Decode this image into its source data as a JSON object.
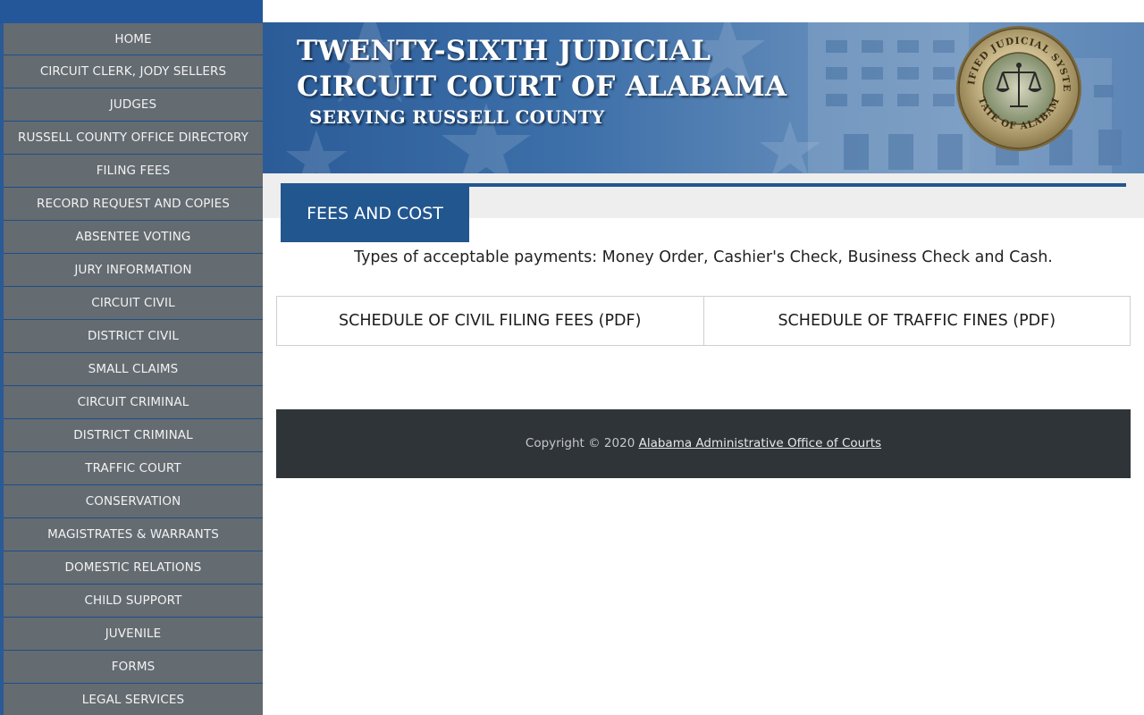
{
  "sidebar": {
    "items": [
      {
        "label": "HOME"
      },
      {
        "label": "CIRCUIT CLERK, JODY SELLERS"
      },
      {
        "label": "JUDGES"
      },
      {
        "label": "RUSSELL COUNTY OFFICE DIRECTORY"
      },
      {
        "label": "FILING FEES"
      },
      {
        "label": "RECORD REQUEST AND COPIES"
      },
      {
        "label": "ABSENTEE VOTING"
      },
      {
        "label": "JURY INFORMATION"
      },
      {
        "label": "CIRCUIT CIVIL"
      },
      {
        "label": "DISTRICT CIVIL"
      },
      {
        "label": "SMALL CLAIMS"
      },
      {
        "label": "CIRCUIT CRIMINAL"
      },
      {
        "label": "DISTRICT CRIMINAL"
      },
      {
        "label": "TRAFFIC COURT"
      },
      {
        "label": "CONSERVATION"
      },
      {
        "label": "MAGISTRATES & WARRANTS"
      },
      {
        "label": "DOMESTIC RELATIONS"
      },
      {
        "label": "CHILD SUPPORT"
      },
      {
        "label": "JUVENILE"
      },
      {
        "label": "FORMS"
      },
      {
        "label": "LEGAL SERVICES"
      }
    ]
  },
  "header": {
    "title_line1": "TWENTY-SIXTH JUDICIAL",
    "title_line2": "CIRCUIT COURT OF ALABAMA",
    "subtitle": "SERVING RUSSELL COUNTY",
    "seal_text_top": "UNIFIED JUDICIAL SYSTEM",
    "seal_text_bottom": "STATE OF ALABAMA"
  },
  "main": {
    "section_title": "FEES AND COST",
    "payments_text": "Types of acceptable payments: Money Order, Cashier's Check, Business Check and Cash.",
    "buttons": {
      "civil_fees": "SCHEDULE OF CIVIL FILING FEES (PDF)",
      "traffic_fines": "SCHEDULE OF TRAFFIC FINES (PDF)"
    }
  },
  "footer": {
    "copyright": "Copyright © 2020",
    "link_text": "Alabama Administrative Office of Courts"
  },
  "colors": {
    "brand_blue": "#22568f",
    "nav_gray": "#646b71",
    "footer_dark": "#2f3438"
  }
}
